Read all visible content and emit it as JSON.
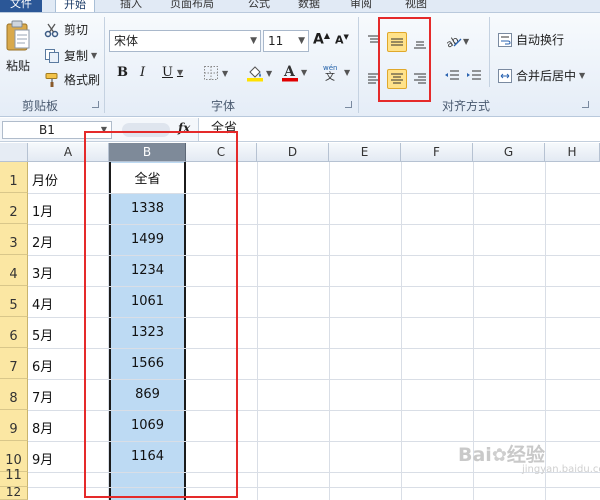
{
  "ribbon": {
    "tabs": [
      "文件",
      "开始",
      "插入",
      "页面布局",
      "公式",
      "数据",
      "审阅",
      "视图"
    ],
    "clipboard": {
      "paste": "粘贴",
      "cut": "剪切",
      "copy": "复制",
      "format_painter": "格式刷",
      "group": "剪贴板"
    },
    "font": {
      "name": "宋体",
      "size": "11",
      "bold": "B",
      "italic": "I",
      "underline": "U",
      "group": "字体"
    },
    "alignment": {
      "wrap_text": "自动换行",
      "merge_center": "合并后居中",
      "group": "对齐方式"
    }
  },
  "formula_bar": {
    "name_box": "B1",
    "fx": "fx",
    "content": "全省"
  },
  "columns": [
    "A",
    "B",
    "C",
    "D",
    "E",
    "F",
    "G",
    "H"
  ],
  "rows": [
    {
      "num": "1",
      "a": "月份",
      "b": "全省"
    },
    {
      "num": "2",
      "a": "1月",
      "b": "1338"
    },
    {
      "num": "3",
      "a": "2月",
      "b": "1499"
    },
    {
      "num": "4",
      "a": "3月",
      "b": "1234"
    },
    {
      "num": "5",
      "a": "4月",
      "b": "1061"
    },
    {
      "num": "6",
      "a": "5月",
      "b": "1323"
    },
    {
      "num": "7",
      "a": "6月",
      "b": "1566"
    },
    {
      "num": "8",
      "a": "7月",
      "b": "869"
    },
    {
      "num": "9",
      "a": "8月",
      "b": "1069"
    },
    {
      "num": "10",
      "a": "9月",
      "b": "1164"
    },
    {
      "num": "11",
      "a": "",
      "b": ""
    },
    {
      "num": "12",
      "a": "",
      "b": ""
    }
  ],
  "watermark": {
    "brand": "Bai",
    "brand2": "经验",
    "url": "jingyan.baidu.com"
  },
  "colors": {
    "selection": "#bddaf3",
    "row_header": "#fbe7a3",
    "highlight_box": "#e52a2a",
    "selected_button": "#ffe28a"
  }
}
